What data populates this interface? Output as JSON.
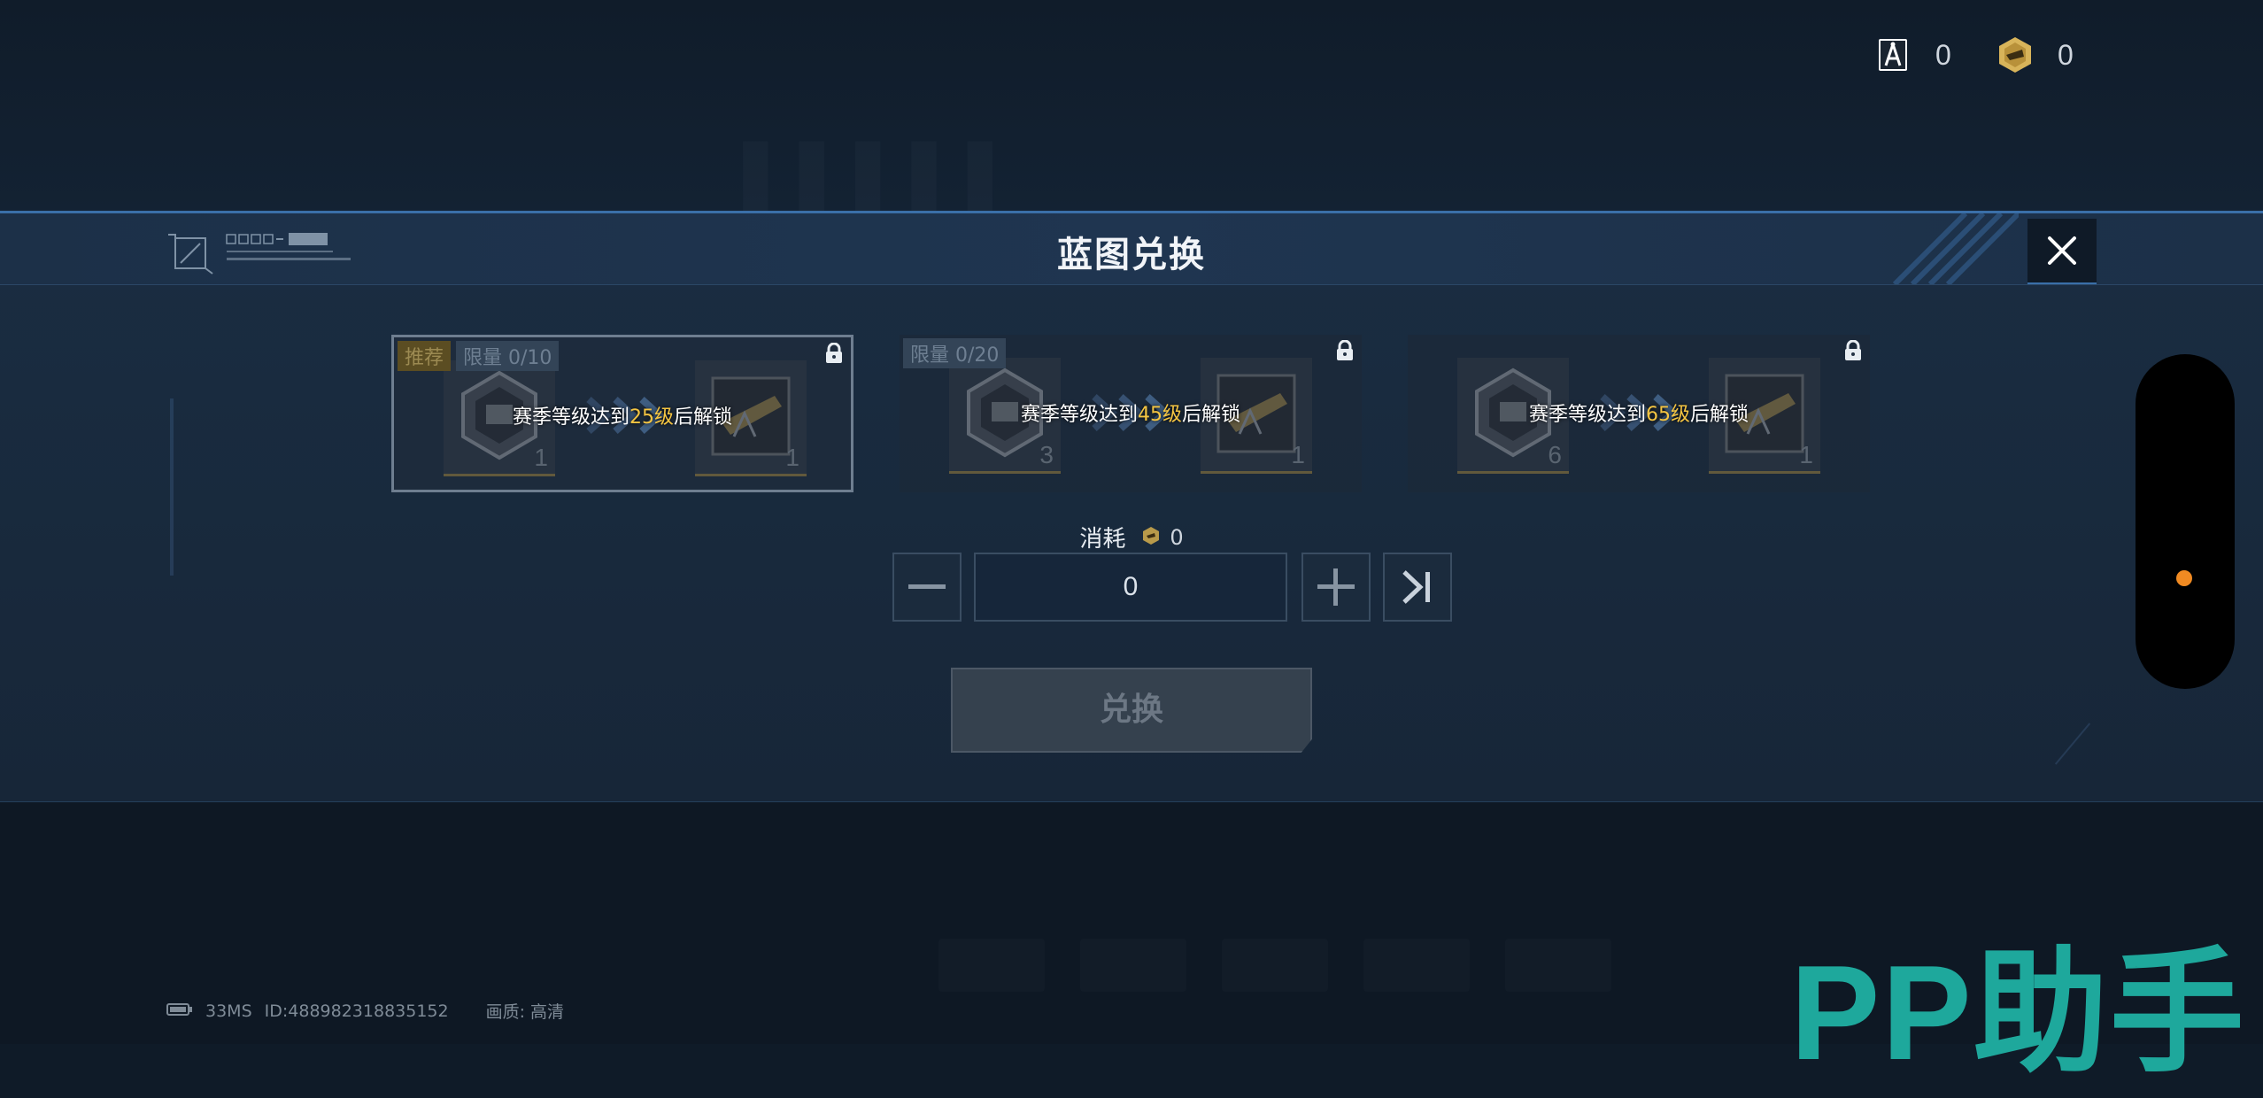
{
  "currency": [
    {
      "icon": "blueprint-ticket-icon",
      "value": "0"
    },
    {
      "icon": "gold-token-icon",
      "value": "0"
    }
  ],
  "modal": {
    "title": "蓝图兑换",
    "close_icon": "close-icon"
  },
  "cards": [
    {
      "recommend_tag": "推荐",
      "limit": "限量 0/10",
      "left_count": "1",
      "right_count": "1",
      "unlock_prefix": "赛季等级达到",
      "unlock_level": "25级",
      "unlock_suffix": "后解锁",
      "selected": true
    },
    {
      "recommend_tag": "",
      "limit": "限量 0/20",
      "left_count": "3",
      "right_count": "1",
      "unlock_prefix": "赛季等级达到",
      "unlock_level": "45级",
      "unlock_suffix": "后解锁",
      "selected": false
    },
    {
      "recommend_tag": "",
      "limit": "",
      "left_count": "6",
      "right_count": "1",
      "unlock_prefix": "赛季等级达到",
      "unlock_level": "65级",
      "unlock_suffix": "后解锁",
      "selected": false
    }
  ],
  "consume": {
    "label": "消耗",
    "value": "0"
  },
  "quantity": {
    "value": "0"
  },
  "exchange_button": "兑换",
  "footer": {
    "ping": "33MS",
    "id": "ID:488982318835152",
    "quality": "画质: 高清"
  },
  "watermark": "PP助手",
  "colors": {
    "accent_blue": "#3a6fa8",
    "level_yellow": "#f5c542",
    "side_dot": "#f08a22",
    "watermark": "#1ea89c"
  }
}
